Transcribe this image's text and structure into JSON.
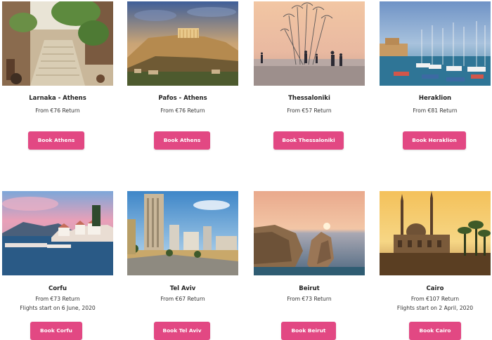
{
  "cards": [
    {
      "title": "Larnaka - Athens",
      "price": "From €76 Return",
      "note": "",
      "button": "Book Athens",
      "image": "athens-street-photo"
    },
    {
      "title": "Pafos - Athens",
      "price": "From €76 Return",
      "note": "",
      "button": "Book Athens",
      "image": "acropolis-photo"
    },
    {
      "title": "Thessaloniki",
      "price": "From €57 Return",
      "note": "",
      "button": "Book Thessaloniki",
      "image": "umbrellas-sculpture-photo"
    },
    {
      "title": "Heraklion",
      "price": "From €81 Return",
      "note": "",
      "button": "Book Heraklion",
      "image": "harbour-photo"
    },
    {
      "title": "Corfu",
      "price": "From €73 Return",
      "note": "Flights start on 6 June, 2020",
      "button": "Book Corfu",
      "image": "corfu-coast-photo"
    },
    {
      "title": "Tel Aviv",
      "price": "From €67 Return",
      "note": "",
      "button": "Book Tel Aviv",
      "image": "tel-aviv-skyline-photo"
    },
    {
      "title": "Beirut",
      "price": "From €73 Return",
      "note": "",
      "button": "Book Beirut",
      "image": "pigeon-rocks-photo"
    },
    {
      "title": "Cairo",
      "price": "From €107 Return",
      "note": "Flights start on 2 April, 2020",
      "button": "Book Cairo",
      "image": "mosque-photo"
    }
  ],
  "colors": {
    "button": "#e24883",
    "button_text": "#ffffff"
  }
}
